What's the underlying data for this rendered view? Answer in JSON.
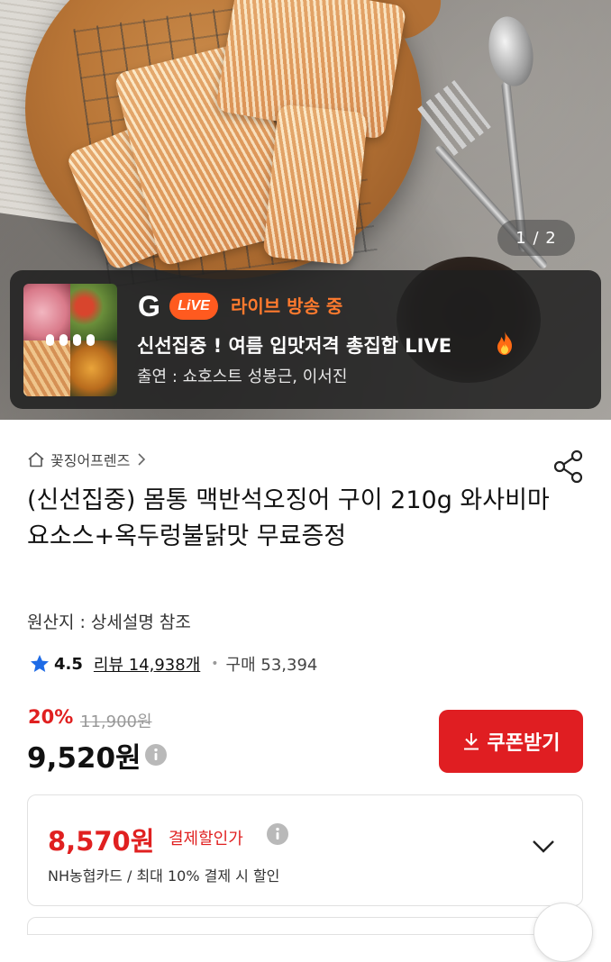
{
  "hero": {
    "page_indicator": "1 / 2"
  },
  "live": {
    "badge_g": "G",
    "badge_live": "LiVE",
    "status": "라이브 방송 중",
    "title": "신선집중 ! 여름 입맛저격 총집합 LIVE",
    "cast": "출연 : 쇼호스트 성봉근, 이서진",
    "accent_color": "#ff5a1f"
  },
  "store": {
    "name": "꽃징어프렌즈"
  },
  "product": {
    "title": "(신선집중) 몸통 맥반석오징어 구이 210g 와사비마요소스+옥두렁불닭맛 무료증정",
    "origin": "원산지 : 상세설명 참조",
    "rating": "4.5",
    "review_label": "리뷰 14,938개",
    "purchase_label": "구매 53,394"
  },
  "price": {
    "discount_rate": "20%",
    "original": "11,900원",
    "sale": "9,520원",
    "coupon_button": "쿠폰받기",
    "accent_color": "#e01e22"
  },
  "card_discount": {
    "price": "8,570원",
    "label": "결제할인가",
    "description": "NH농협카드 / 최대 10% 결제 시 할인"
  }
}
